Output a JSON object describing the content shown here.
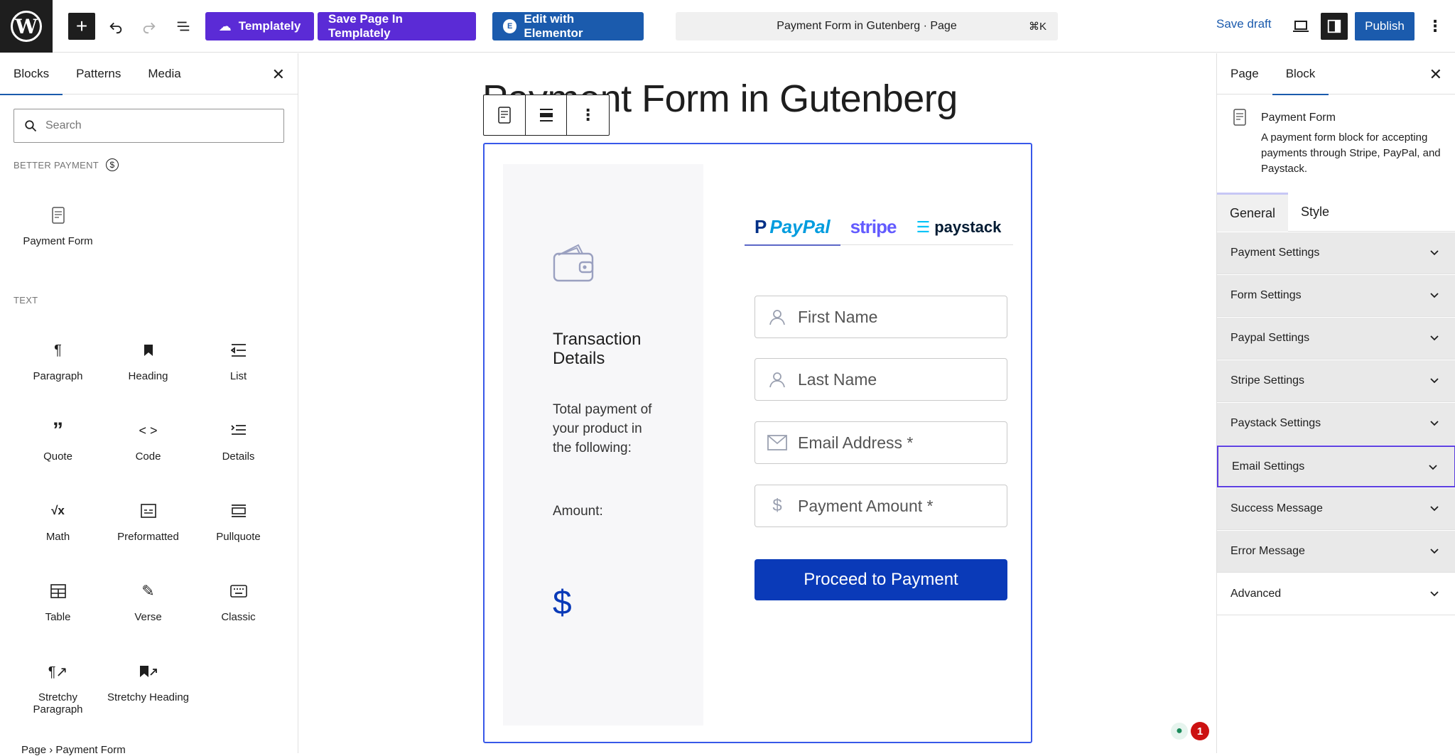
{
  "topbar": {
    "templately_label": "Templately",
    "save_templately_label": "Save Page In Templately",
    "elementor_label": "Edit with Elementor",
    "command_title": "Payment Form in Gutenberg · Page",
    "command_shortcut": "⌘K",
    "save_draft_label": "Save draft",
    "publish_label": "Publish"
  },
  "inserter": {
    "tabs": [
      "Blocks",
      "Patterns",
      "Media"
    ],
    "search_placeholder": "Search",
    "sections": {
      "better_payment": "Better Payment",
      "text": "Text"
    },
    "better_payment_blocks": [
      {
        "label": "Payment Form",
        "icon": "payment-form-icon"
      }
    ],
    "text_blocks": [
      {
        "label": "Paragraph",
        "icon": "paragraph-icon"
      },
      {
        "label": "Heading",
        "icon": "heading-icon"
      },
      {
        "label": "List",
        "icon": "list-icon"
      },
      {
        "label": "Quote",
        "icon": "quote-icon"
      },
      {
        "label": "Code",
        "icon": "code-icon"
      },
      {
        "label": "Details",
        "icon": "details-icon"
      },
      {
        "label": "Math",
        "icon": "math-icon"
      },
      {
        "label": "Preformatted",
        "icon": "preformatted-icon"
      },
      {
        "label": "Pullquote",
        "icon": "pullquote-icon"
      },
      {
        "label": "Table",
        "icon": "table-icon"
      },
      {
        "label": "Verse",
        "icon": "verse-icon"
      },
      {
        "label": "Classic",
        "icon": "classic-icon"
      },
      {
        "label": "Stretchy Paragraph",
        "icon": "stretchy-paragraph-icon"
      },
      {
        "label": "Stretchy Heading",
        "icon": "stretchy-heading-icon"
      }
    ],
    "breadcrumb": "Page  ›  Payment Form"
  },
  "canvas": {
    "page_title": "Payment Form in Gutenberg",
    "transaction_title": "Transaction Details",
    "transaction_desc": "Total payment of your product in the following:",
    "amount_label": "Amount:",
    "currency_symbol": "$",
    "gateways": [
      "PayPal",
      "stripe",
      "paystack"
    ],
    "fields": {
      "first_name": "First Name",
      "last_name": "Last Name",
      "email": "Email Address *",
      "amount": "Payment Amount *"
    },
    "proceed_label": "Proceed to Payment",
    "notification_count": "1"
  },
  "sidebar": {
    "tabs": [
      "Page",
      "Block"
    ],
    "block_title": "Payment Form",
    "block_desc": "A payment form block for accepting payments through Stripe, PayPal, and Paystack.",
    "settings_tabs": [
      "General",
      "Style"
    ],
    "panels": [
      "Payment Settings",
      "Form Settings",
      "Paypal Settings",
      "Stripe Settings",
      "Paystack Settings",
      "Email Settings",
      "Success Message",
      "Error Message",
      "Advanced"
    ]
  },
  "colors": {
    "wp_dark": "#1e1e1e",
    "admin_blue": "#1b5bad",
    "templately_purple": "#5b2bd6",
    "payment_blue": "#0a3ab8",
    "selection_blue": "#3858e9"
  }
}
